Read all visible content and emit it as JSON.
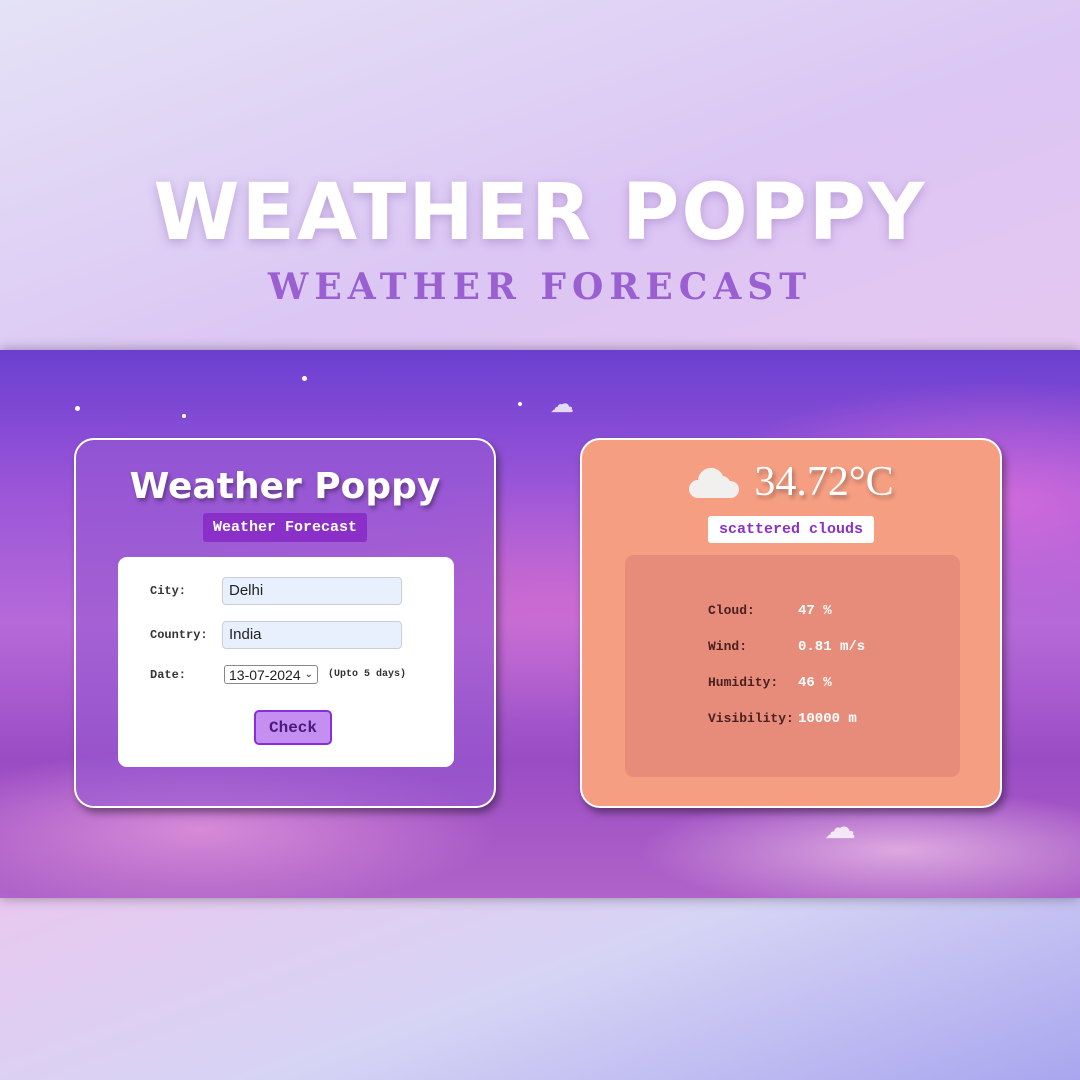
{
  "hero": {
    "title": "WEATHER POPPY",
    "subtitle": "WEATHER FORECAST"
  },
  "form_card": {
    "title": "Weather Poppy",
    "badge": "Weather Forecast",
    "city_label": "City:",
    "city_value": "Delhi",
    "country_label": "Country:",
    "country_value": "India",
    "date_label": "Date:",
    "date_value": "13-07-2024",
    "date_note": "(Upto 5 days)",
    "check_label": "Check"
  },
  "result_card": {
    "temperature": "34.72°C",
    "description": "scattered clouds",
    "stats": [
      {
        "label": "Cloud:",
        "value": "47 %"
      },
      {
        "label": "Wind:",
        "value": "0.81 m/s"
      },
      {
        "label": "Humidity:",
        "value": "46 %"
      },
      {
        "label": "Visibility:",
        "value": "10000 m"
      }
    ]
  },
  "colors": {
    "accent": "#8a30c8",
    "result_bg": "#f59e82"
  }
}
